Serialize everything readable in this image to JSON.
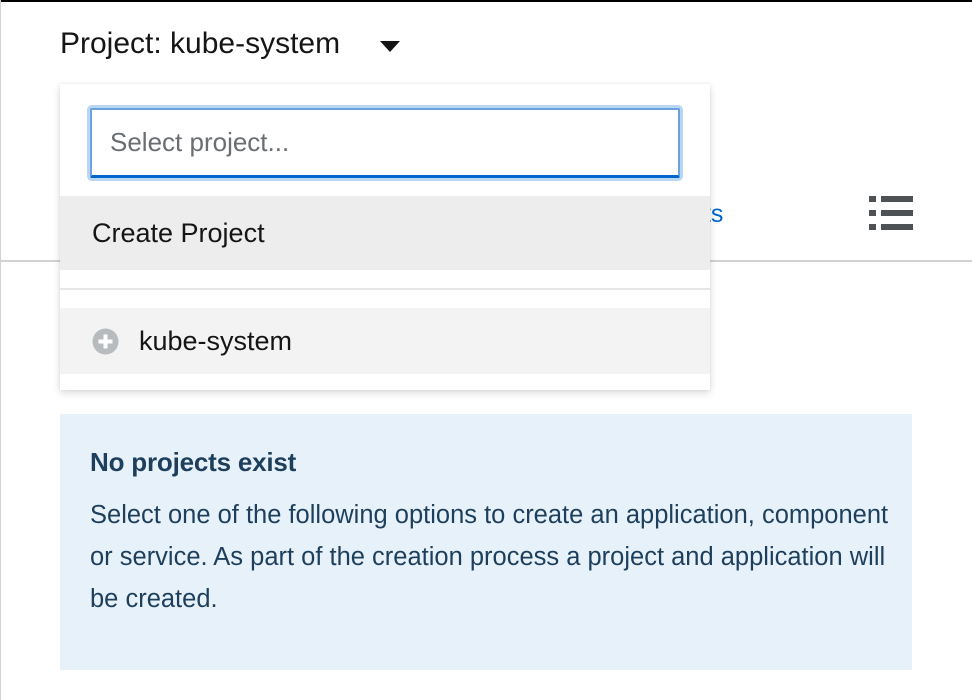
{
  "header": {
    "project_toggle_label": "Project: kube-system"
  },
  "background": {
    "partial_link_text": "uts"
  },
  "dropdown": {
    "search": {
      "placeholder": "Select project...",
      "value": ""
    },
    "create_label": "Create Project",
    "projects": [
      {
        "label": "kube-system",
        "icon": "plus-circle-icon"
      }
    ]
  },
  "empty_state": {
    "title": "No projects exist",
    "body": "Select one of the following options to create an application, component or service. As part of the creation process a project and application will be created."
  },
  "colors": {
    "link": "#0066cc",
    "alert_bg": "#e7f1fa",
    "alert_text": "#1d3f5c",
    "focus_border": "#0066cc"
  }
}
